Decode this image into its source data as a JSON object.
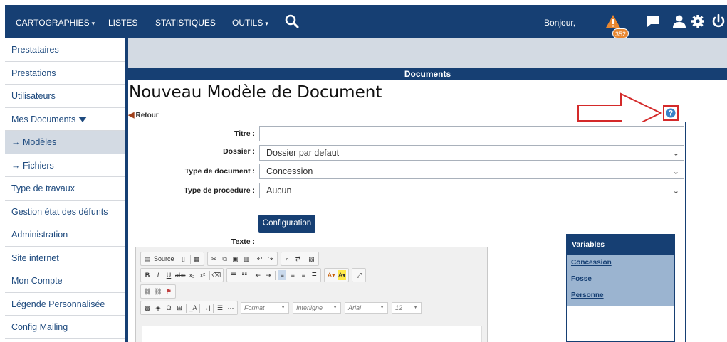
{
  "nav": {
    "cartographies": "CARTOGRAPHIES",
    "listes": "LISTES",
    "statistiques": "STATISTIQUES",
    "outils": "OUTILS",
    "greeting": "Bonjour,",
    "alert_count": "352"
  },
  "sidebar": {
    "items": [
      {
        "label": "Prestataires"
      },
      {
        "label": "Prestations"
      },
      {
        "label": "Utilisateurs"
      },
      {
        "label": "Mes Documents"
      },
      {
        "label": "→ Modèles"
      },
      {
        "label": "→ Fichiers"
      },
      {
        "label": "Type de travaux"
      },
      {
        "label": "Gestion état des défunts"
      },
      {
        "label": "Administration"
      },
      {
        "label": "Site internet"
      },
      {
        "label": "Mon Compte"
      },
      {
        "label": "Légende Personnalisée"
      },
      {
        "label": "Config Mailing"
      }
    ]
  },
  "main": {
    "section": "Documents",
    "title": "Nouveau Modèle de Document",
    "back": "Retour"
  },
  "form": {
    "titre_label": "Titre :",
    "titre_value": "",
    "dossier_label": "Dossier :",
    "dossier_value": "Dossier par defaut",
    "type_doc_label": "Type de document :",
    "type_doc_value": "Concession",
    "type_proc_label": "Type de procedure :",
    "type_proc_value": "Aucun",
    "config_button": "Configuration",
    "texte_label": "Texte :"
  },
  "editor": {
    "source": "Source",
    "format": "Format",
    "interligne": "Interligne",
    "font": "Arial",
    "size": "12"
  },
  "variables": {
    "header": "Variables",
    "items": [
      "Concession",
      "Fosse",
      "Personne"
    ]
  },
  "colors": {
    "navy": "#163f73",
    "light": "#d3dae3",
    "highlight": "#d42a2a"
  }
}
